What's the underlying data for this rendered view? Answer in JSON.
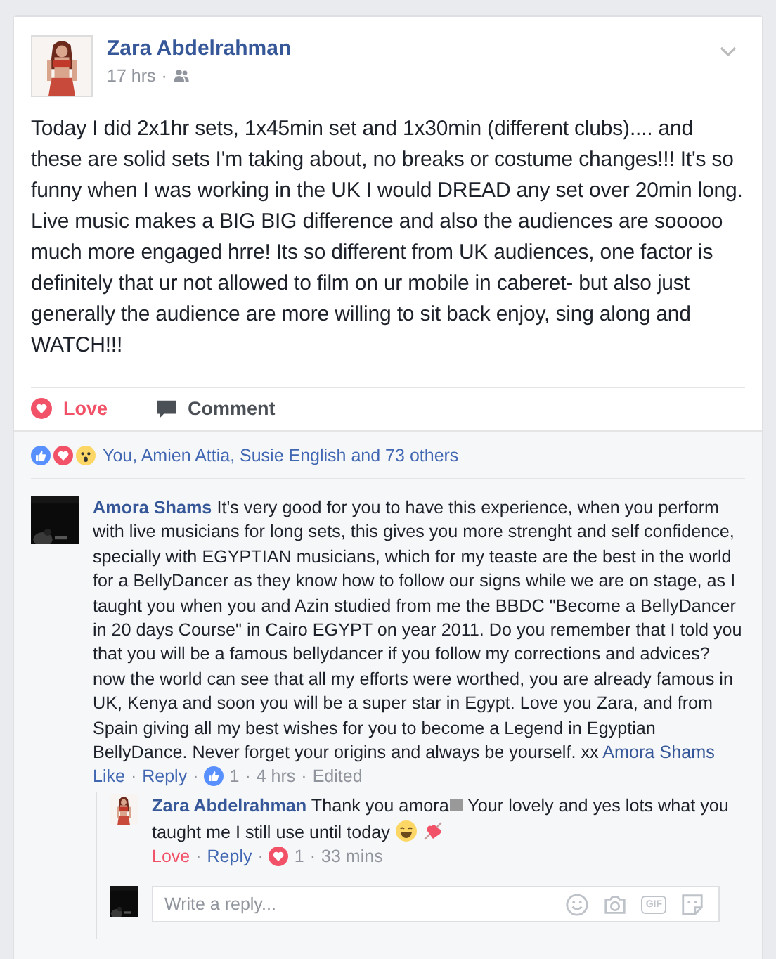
{
  "post": {
    "author": "Zara Abdelrahman",
    "time": "17 hrs",
    "separator": "·",
    "text": "Today I did 2x1hr sets, 1x45min set and 1x30min (different clubs).... and these are solid sets I'm taking about, no breaks or costume changes!!! It's so funny when I was working in the UK I would DREAD any set over 20min long. Live music makes a BIG BIG difference and also the audiences are sooooo much more engaged hrre! Its so different from UK audiences, one factor is definitely that ur not allowed to film on ur mobile in caberet- but also just generally the audience are more willing to sit back enjoy, sing along and WATCH!!!",
    "actions": [
      {
        "kind": "love",
        "label": "Love",
        "active": true
      },
      {
        "kind": "comment",
        "label": "Comment",
        "active": false
      }
    ],
    "reactions_summary": "You, Amien Attia, Susie English and 73 others"
  },
  "comments": [
    {
      "author": "Amora Shams",
      "text": "It's very good for you to have this experience, when you perform with live musicians for long sets, this gives you more strenght and self confidence, specially with EGYPTIAN musicians, which for my teaste are the best in the world for a BellyDancer as they know how to follow our signs while we are on stage, as I taught you when you and Azin studied from me the BBDC \"Become a BellyDancer in 20 days Course\" in Cairo EGYPT on year 2011. Do you remember that I told you that you will be a famous bellydancer if you follow my corrections and advices? now the world can see that all my efforts were worthed, you are already famous in UK, Kenya and soon you will be a super star in Egypt. Love you Zara, and from Spain giving all my best wishes for you to become a Legend in Egyptian BellyDance. Never forget your origins and always be yourself. xx",
      "signature": "Amora Shams",
      "reaction": {
        "label": "Like",
        "active": false
      },
      "reply_label": "Reply",
      "reaction_count": {
        "kind": "like",
        "count": "1"
      },
      "time": "4 hrs",
      "edited": "Edited",
      "replies": [
        {
          "author": "Zara Abdelrahman",
          "text": "Thank you amora",
          "text_after": "Your lovely and yes lots what you taught me I still use until today",
          "reaction": {
            "kind": "love",
            "label": "Love",
            "active": true
          },
          "reply_label": "Reply",
          "reaction_count": {
            "kind": "love",
            "count": "1"
          },
          "time": "33 mins"
        }
      ]
    }
  ],
  "meta_separator": "·",
  "reply_box": {
    "placeholder": "Write a reply...",
    "gif_label": "GIF"
  }
}
